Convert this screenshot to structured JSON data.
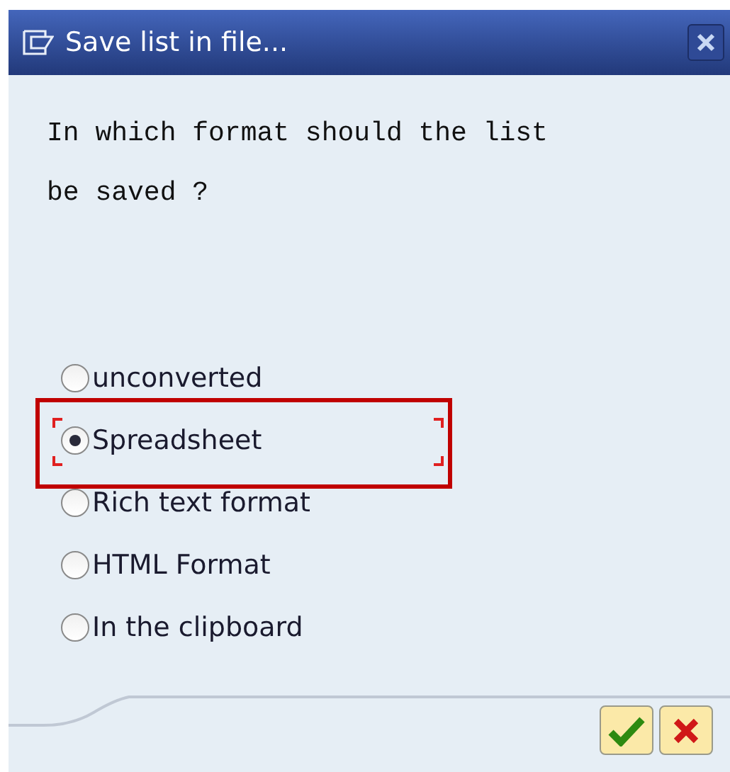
{
  "window": {
    "title": "Save list in file..."
  },
  "question": [
    "In which format should the list",
    "be saved ?"
  ],
  "options": [
    {
      "label": "unconverted",
      "selected": false
    },
    {
      "label": "Spreadsheet",
      "selected": true
    },
    {
      "label": "Rich text format",
      "selected": false
    },
    {
      "label": "HTML Format",
      "selected": false
    },
    {
      "label": "In the clipboard",
      "selected": false
    }
  ]
}
